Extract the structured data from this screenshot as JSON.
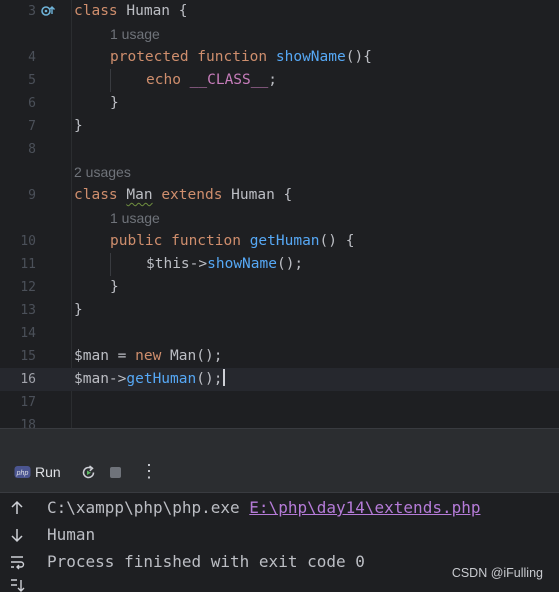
{
  "editor": {
    "lines": [
      {
        "num": "3",
        "tokens": [
          [
            "kw",
            "class "
          ],
          [
            "cls",
            "Human"
          ],
          [
            "punct",
            " {"
          ]
        ]
      },
      {
        "num": "",
        "hint": "1 usage",
        "indent": 1
      },
      {
        "num": "4",
        "indent": 1,
        "tokens": [
          [
            "kw",
            "protected function "
          ],
          [
            "fn",
            "showName"
          ],
          [
            "punct",
            "(){"
          ]
        ]
      },
      {
        "num": "5",
        "indent": 2,
        "tokens": [
          [
            "kw",
            "echo "
          ],
          [
            "const",
            "__CLASS__"
          ],
          [
            "punct",
            ";"
          ]
        ]
      },
      {
        "num": "6",
        "indent": 1,
        "tokens": [
          [
            "punct",
            "}"
          ]
        ]
      },
      {
        "num": "7",
        "tokens": [
          [
            "punct",
            "}"
          ]
        ]
      },
      {
        "num": "8",
        "tokens": []
      },
      {
        "num": "",
        "hint": "2 usages",
        "indent": 0
      },
      {
        "num": "9",
        "tokens": [
          [
            "kw",
            "class "
          ],
          [
            "cls-decl",
            "Man"
          ],
          [
            "kw",
            " extends "
          ],
          [
            "cls",
            "Human"
          ],
          [
            "punct",
            " {"
          ]
        ]
      },
      {
        "num": "",
        "hint": "1 usage",
        "indent": 1
      },
      {
        "num": "10",
        "indent": 1,
        "tokens": [
          [
            "kw",
            "public function "
          ],
          [
            "fn",
            "getHuman"
          ],
          [
            "punct",
            "() {"
          ]
        ]
      },
      {
        "num": "11",
        "indent": 2,
        "tokens": [
          [
            "var",
            "$this"
          ],
          [
            "punct",
            "->"
          ],
          [
            "fn",
            "showName"
          ],
          [
            "punct",
            "();"
          ]
        ]
      },
      {
        "num": "12",
        "indent": 1,
        "tokens": [
          [
            "punct",
            "}"
          ]
        ]
      },
      {
        "num": "13",
        "tokens": [
          [
            "punct",
            "}"
          ]
        ]
      },
      {
        "num": "14",
        "tokens": []
      },
      {
        "num": "15",
        "tokens": [
          [
            "var",
            "$man"
          ],
          [
            "punct",
            " = "
          ],
          [
            "kw",
            "new "
          ],
          [
            "cls",
            "Man"
          ],
          [
            "punct",
            "();"
          ]
        ]
      },
      {
        "num": "16",
        "current": true,
        "tokens": [
          [
            "var",
            "$man"
          ],
          [
            "punct",
            "->"
          ],
          [
            "fn",
            "getHuman"
          ],
          [
            "punct",
            "();"
          ]
        ]
      },
      {
        "num": "17",
        "tokens": []
      },
      {
        "num": "18",
        "tokens": []
      }
    ]
  },
  "run_panel": {
    "run_label": "Run",
    "icons": [
      "php-icon",
      "rerun-icon",
      "stop-icon",
      "more-options-icon"
    ],
    "more_glyph": "⋮"
  },
  "console": {
    "side_icons": [
      "arrow-up-icon",
      "arrow-down-icon",
      "soft-wrap-icon",
      "scroll-to-end-icon"
    ],
    "command": "C:\\xampp\\php\\php.exe",
    "script_path": "E:\\php\\day14\\extends.php",
    "output": "Human",
    "exit_message": "Process finished with exit code 0"
  },
  "watermark": "CSDN @iFulling",
  "colors": {
    "background": "#1e1f22",
    "keyword": "#cf8e6d",
    "function": "#56a8f5",
    "constant": "#c77dbb",
    "link": "#b57bd8",
    "text": "#bcbec4"
  }
}
